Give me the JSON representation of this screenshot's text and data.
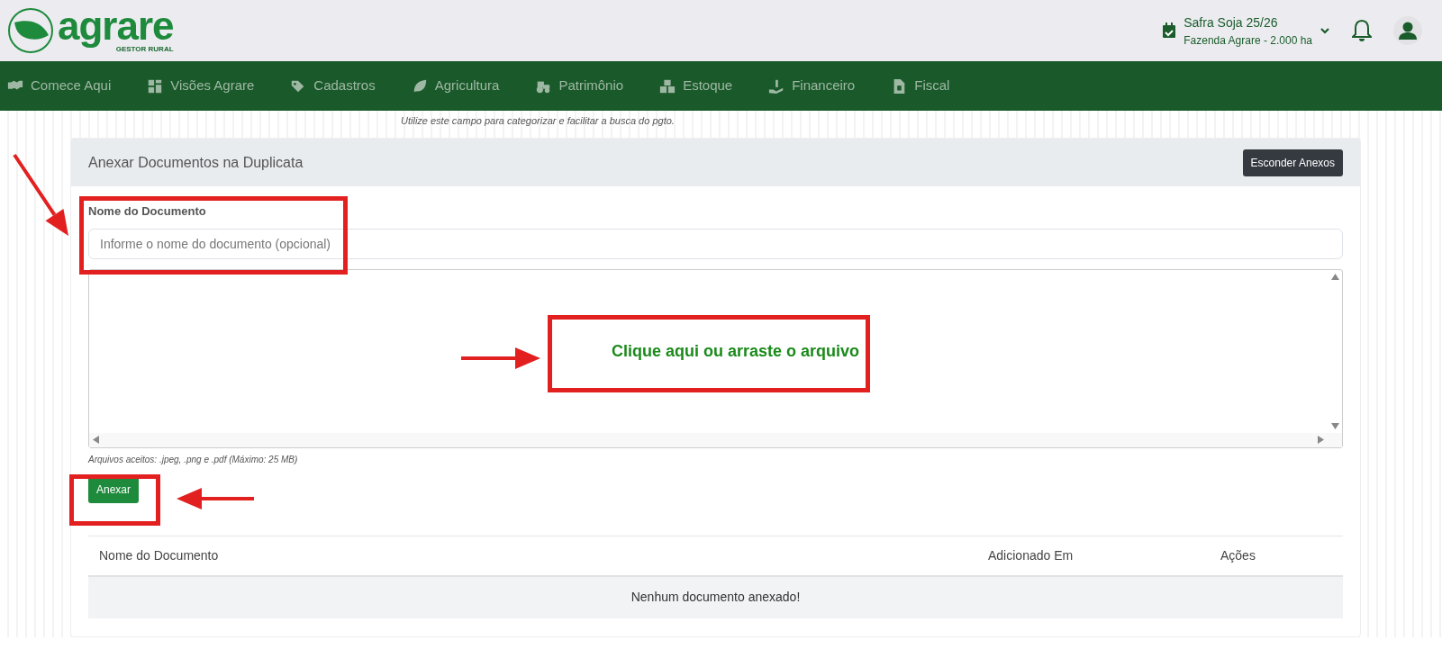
{
  "header": {
    "logo": {
      "name": "agrare",
      "tagline": "GESTOR RURAL"
    },
    "season": {
      "title": "Safra Soja 25/26",
      "farm": "Fazenda Agrare - 2.000 ha"
    }
  },
  "nav": [
    {
      "label": "Comece Aqui"
    },
    {
      "label": "Visões Agrare"
    },
    {
      "label": "Cadastros"
    },
    {
      "label": "Agricultura"
    },
    {
      "label": "Patrimônio"
    },
    {
      "label": "Estoque"
    },
    {
      "label": "Financeiro"
    },
    {
      "label": "Fiscal"
    }
  ],
  "field_hint": "Utilize este campo para categorizar e facilitar a busca do pgto.",
  "attachments": {
    "title": "Anexar Documentos na Duplicata",
    "toggle_button": "Esconder Anexos",
    "name_field": {
      "label": "Nome do Documento",
      "placeholder": "Informe o nome do documento (opcional)"
    },
    "dropzone_text": "Clique aqui ou arraste o arquivo",
    "accepted_hint": "Arquivos aceitos: .jpeg, .png e .pdf (Máximo: 25 MB)",
    "submit_button": "Anexar",
    "table": {
      "columns": [
        "Nome do Documento",
        "Adicionado Em",
        "Ações"
      ],
      "empty_message": "Nenhum documento anexado!"
    }
  }
}
